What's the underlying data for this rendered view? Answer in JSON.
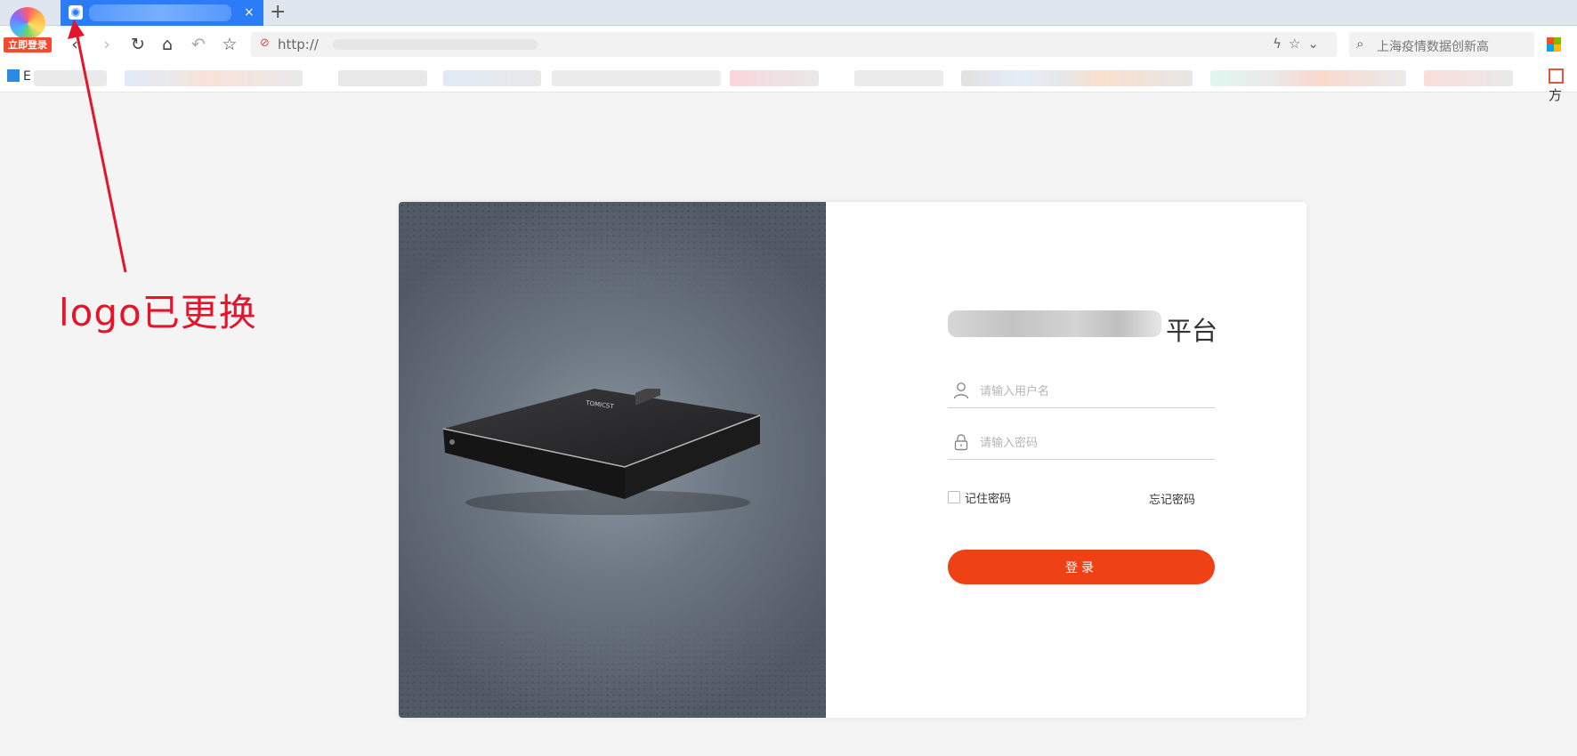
{
  "browser": {
    "login_badge": "立即登录",
    "tab": {
      "title": "",
      "close": "×"
    },
    "new_tab": "+",
    "nav": {
      "back": "‹",
      "forward": "›",
      "reload": "↻",
      "home": "⌂",
      "undo": "↶",
      "favorite": "☆"
    },
    "address": {
      "url": "http://",
      "lock_icon": "⊘"
    },
    "search": {
      "placeholder": "上海疫情数据创新高"
    },
    "bookmarks": {
      "first": "E",
      "last": "方"
    }
  },
  "annotation": {
    "text": "logo已更换",
    "color": "#e5142b"
  },
  "login": {
    "title_visible": "平台",
    "username_placeholder": "请输入用户名",
    "password_placeholder": "请输入密码",
    "remember_label": "记住密码",
    "forgot_label": "忘记密码",
    "submit_label": "登录"
  },
  "colors": {
    "accent": "#ee4216",
    "tab_active": "#2b7cf6"
  }
}
